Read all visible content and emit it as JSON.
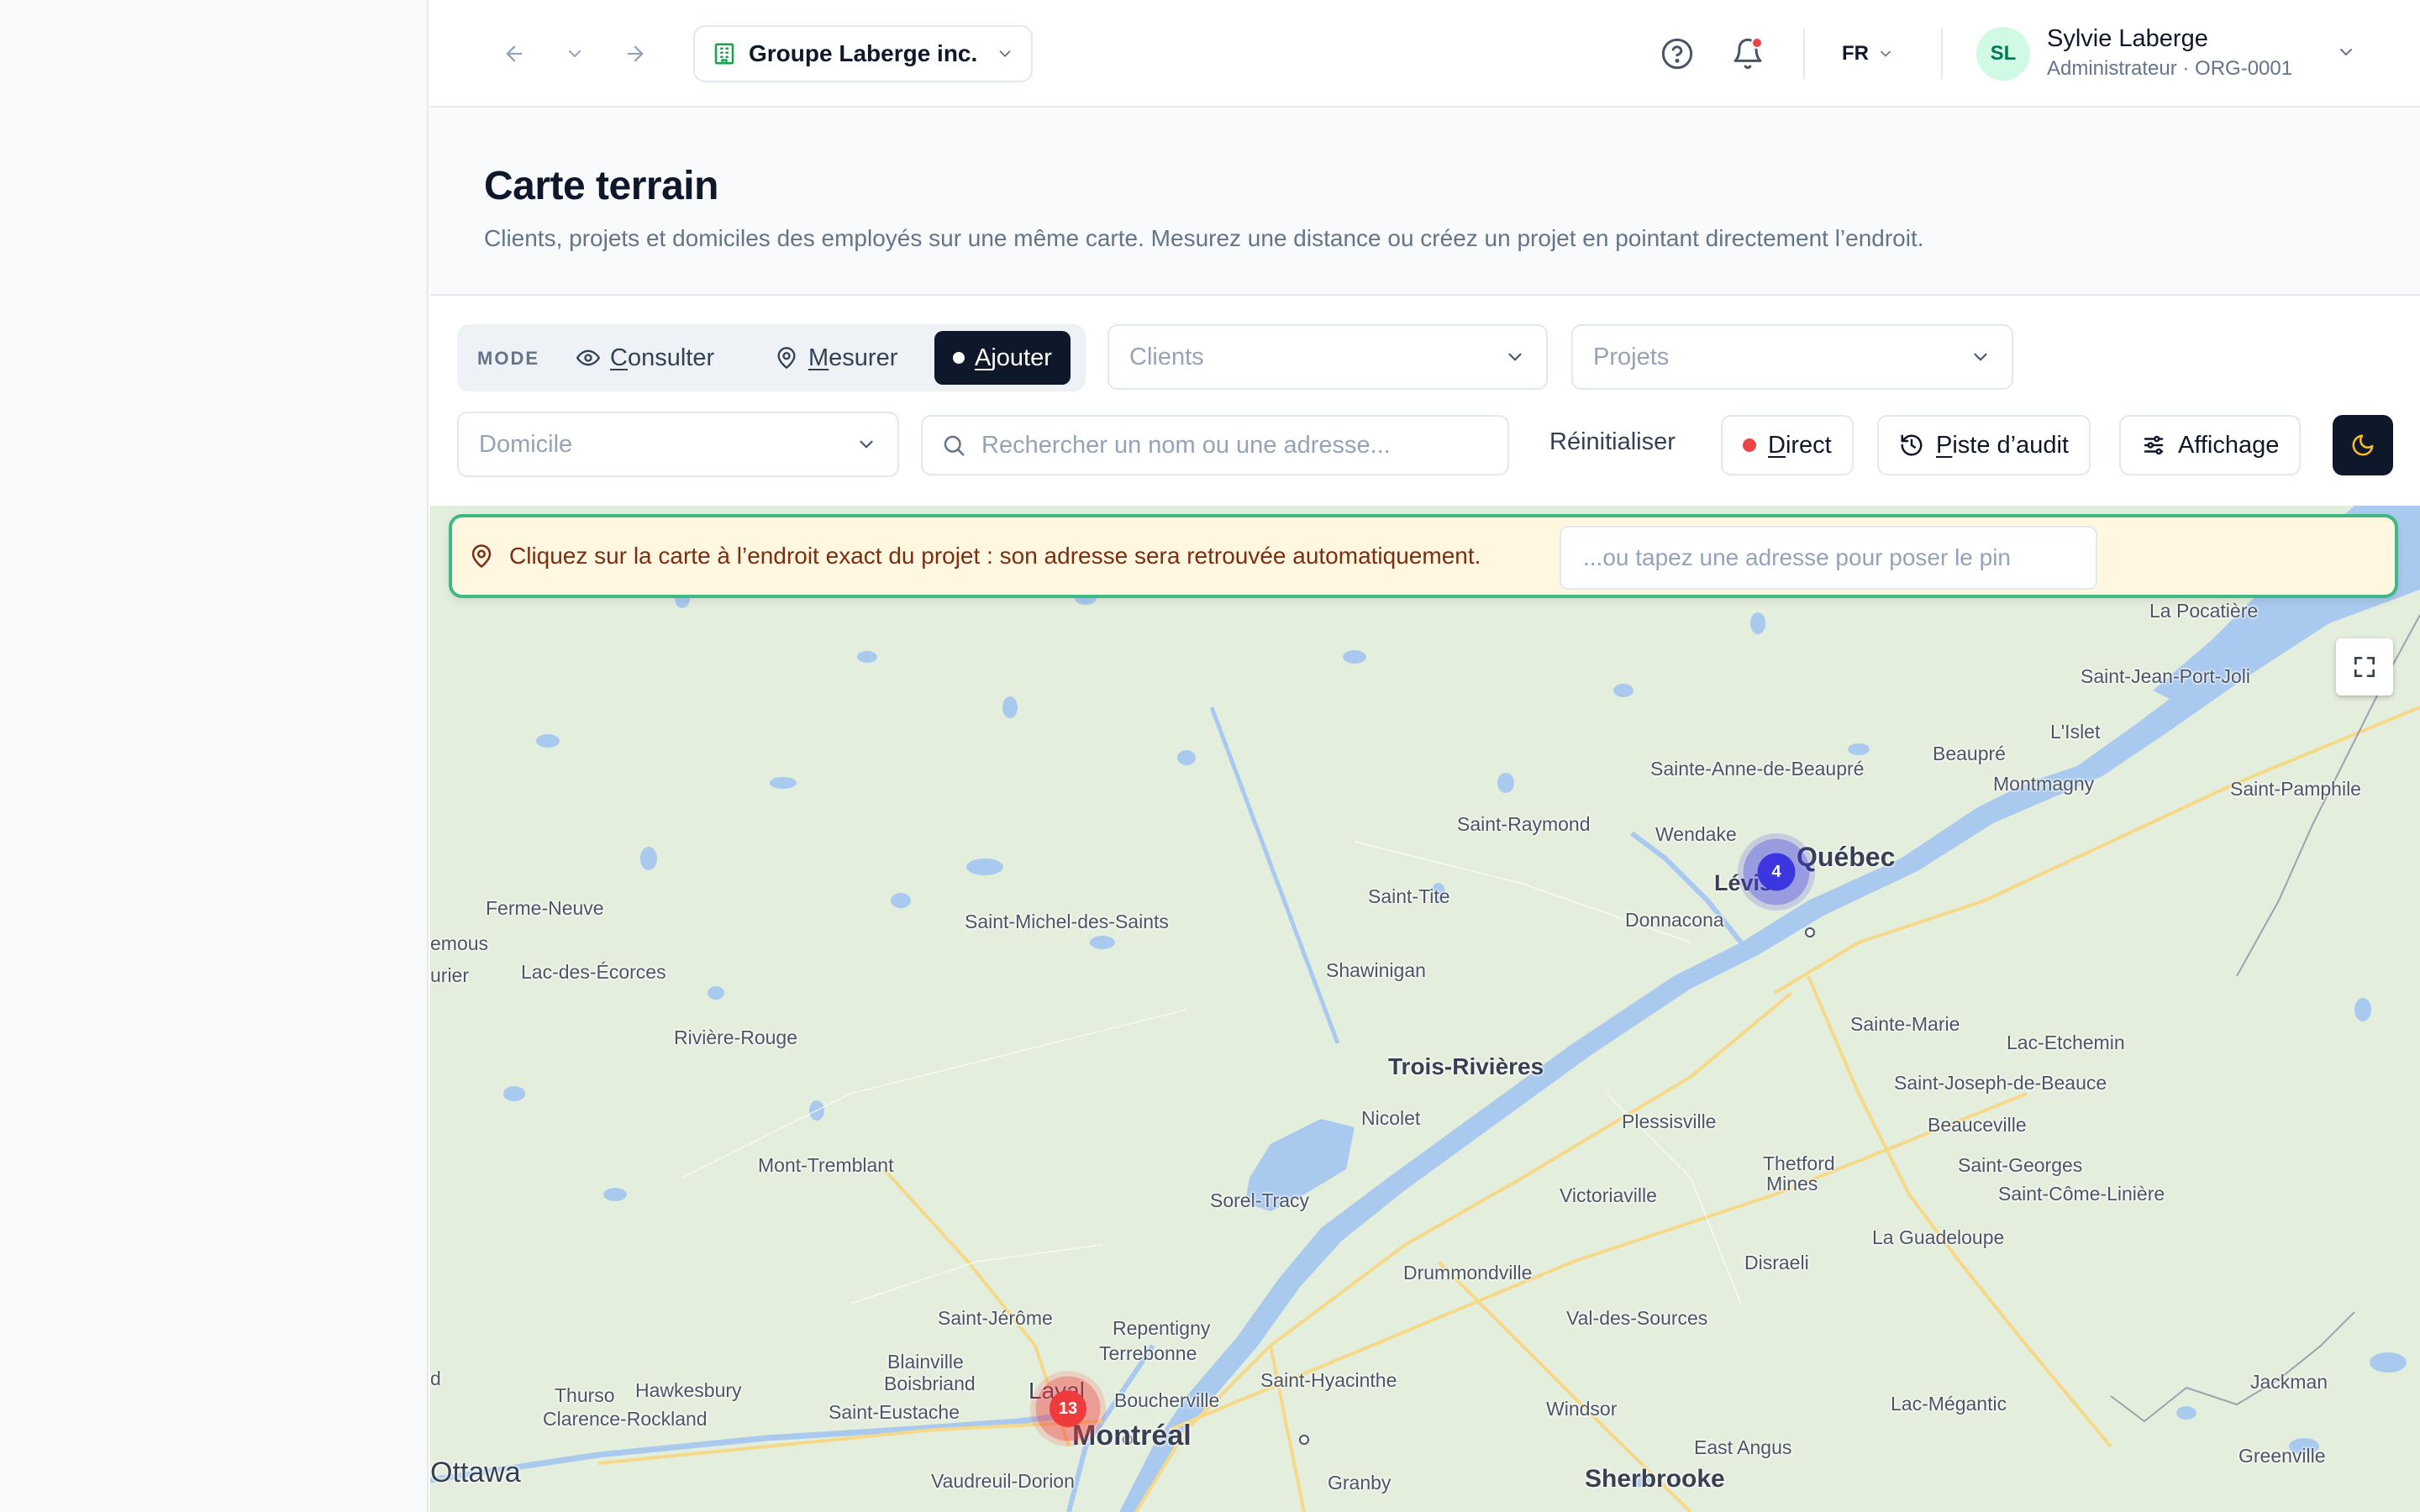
{
  "topbar": {
    "organization": "Groupe Laberge inc.",
    "language": "FR",
    "user": {
      "initials": "SL",
      "name": "Sylvie Laberge",
      "role": "Administrateur · ORG-0001"
    },
    "icons": {
      "back": "arrow-left-icon",
      "history": "chevron-down-icon",
      "forward": "arrow-right-icon",
      "help": "help-circle-icon",
      "notifications": "bell-icon",
      "org": "building-icon"
    }
  },
  "header": {
    "title": "Carte terrain",
    "subtitle": "Clients, projets et domiciles des employés sur une même carte. Mesurez une distance ou créez un projet en pointant directement l’endroit."
  },
  "toolbar": {
    "mode_label": "MODE",
    "modes": [
      {
        "first": "C",
        "rest": "onsulter",
        "icon": "eye-icon",
        "active": false
      },
      {
        "first": "M",
        "rest": "esurer",
        "icon": "pin-icon",
        "active": false
      },
      {
        "first": "A",
        "rest": "jouter",
        "icon": "dot-icon",
        "active": true
      }
    ],
    "clients_placeholder": "Clients",
    "projects_placeholder": "Projets",
    "home_placeholder": "Domicile",
    "search_placeholder": "Rechercher un nom ou une adresse...",
    "reset_label": "Réinitialiser",
    "live": {
      "first": "D",
      "rest": "irect"
    },
    "audit": {
      "first": "P",
      "rest": "iste d’audit"
    },
    "display_label": "Affichage",
    "theme_icon": "moon-icon"
  },
  "map": {
    "banner_message": "Cliquez sur la carte à l’endroit exact du projet : son adresse sera retrouvée automatiquement.",
    "banner_input_placeholder": "...ou tapez une adresse pour poser le pin",
    "colors": {
      "land": "#e4eedc",
      "water": "#a9c9ee",
      "road": "#f6d889",
      "cluster_blue": "#3b36e0",
      "cluster_red": "#ef3b3b"
    },
    "clusters": [
      {
        "label": "4",
        "color": "blue"
      },
      {
        "label": "13",
        "color": "red"
      }
    ],
    "places": [
      "La Pocatière",
      "Saint-Jean-Port-Joli",
      "L'Islet",
      "Sainte-Anne-de-Beaupré",
      "Beaupré",
      "Montmagny",
      "Saint-Pamphile",
      "Saint-Raymond",
      "Wendake",
      "Québec",
      "Lévis",
      "Saint-Tite",
      "Donnacona",
      "Ferme-Neuve",
      "emous",
      "urier",
      "Lac-des-Écorces",
      "Saint-Michel-des-Saints",
      "Shawinigan",
      "Rivière-Rouge",
      "Sainte-Marie",
      "Lac-Etchemin",
      "Trois-Rivières",
      "Saint-Joseph-de-Beauce",
      "Nicolet",
      "Plessisville",
      "Beauceville",
      "Mont-Tremblant",
      "Thetford",
      "Mines",
      "Saint-Georges",
      "Saint-Côme-Linière",
      "Sorel-Tracy",
      "Victoriaville",
      "La Guadeloupe",
      "Disraeli",
      "Drummondville",
      "Saint-Jérôme",
      "Repentigny",
      "Val-des-Sources",
      "Terrebonne",
      "Blainville",
      "Boisbriand",
      "Saint-Hyacinthe",
      "Jackman",
      "Thurso",
      "Hawkesbury",
      "Laval",
      "Boucherville",
      "Saint-Eustache",
      "Clarence-Rockland",
      "Lac-Mégantic",
      "Windsor",
      "Montréal",
      "d",
      "Ottawa",
      "East Angus",
      "Greenville",
      "Vaudreuil-Dorion",
      "Granby",
      "Sherbrooke"
    ]
  }
}
